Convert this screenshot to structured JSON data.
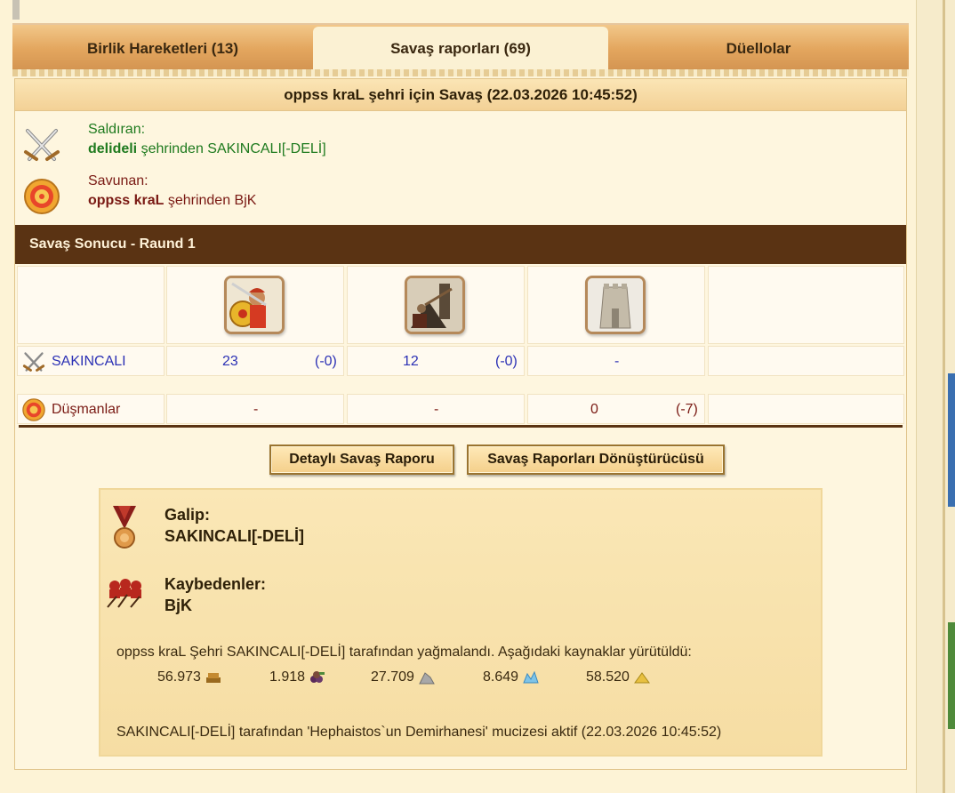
{
  "tabs": [
    {
      "label": "Birlik Hareketleri (13)"
    },
    {
      "label": "Savaş raporları (69)"
    },
    {
      "label": "Düellolar"
    }
  ],
  "report": {
    "title": "oppss kraL şehri için Savaş (22.03.2026 10:45:52)",
    "attacker_label": "Saldıran:",
    "attacker_city": "delideli",
    "attacker_rest": "şehrinden SAKINCALI[-DELİ]",
    "defender_label": "Savunan:",
    "defender_city": "oppss kraL",
    "defender_rest": "şehrinden BjK"
  },
  "result_title": "Savaş Sonucu - Raund 1",
  "units": [
    "swordsman-unit",
    "catapult-unit",
    "wall-unit"
  ],
  "rows": [
    {
      "name": "SAKINCALI",
      "cells": [
        [
          "23",
          "(-0)"
        ],
        [
          "12",
          "(-0)"
        ],
        [
          "-",
          ""
        ]
      ]
    },
    {
      "name": "Düşmanlar",
      "cells": [
        [
          "-",
          ""
        ],
        [
          "-",
          ""
        ],
        [
          "0",
          "(-7)"
        ]
      ]
    }
  ],
  "buttons": {
    "detail": "Detaylı Savaş Raporu",
    "converter": "Savaş Raporları Dönüştürücüsü"
  },
  "summary": {
    "winner_label": "Galip:",
    "winner": "SAKINCALI[-DELİ]",
    "losers_label": "Kaybedenler:",
    "losers": "BjK",
    "plunder_text": "oppss kraL Şehri SAKINCALI[-DELİ] tarafından yağmalandı. Aşağıdaki kaynaklar yürütüldü:",
    "resources": [
      {
        "amount": "56.973",
        "icon": "wood-icon"
      },
      {
        "amount": "1.918",
        "icon": "wine-icon"
      },
      {
        "amount": "27.709",
        "icon": "marble-icon"
      },
      {
        "amount": "8.649",
        "icon": "crystal-icon"
      },
      {
        "amount": "58.520",
        "icon": "sulfur-icon"
      }
    ],
    "wonder_text": "SAKINCALI[-DELİ] tarafından 'Hephaistos`un Demirhanesi' mucizesi aktif (22.03.2026 10:45:52)"
  }
}
